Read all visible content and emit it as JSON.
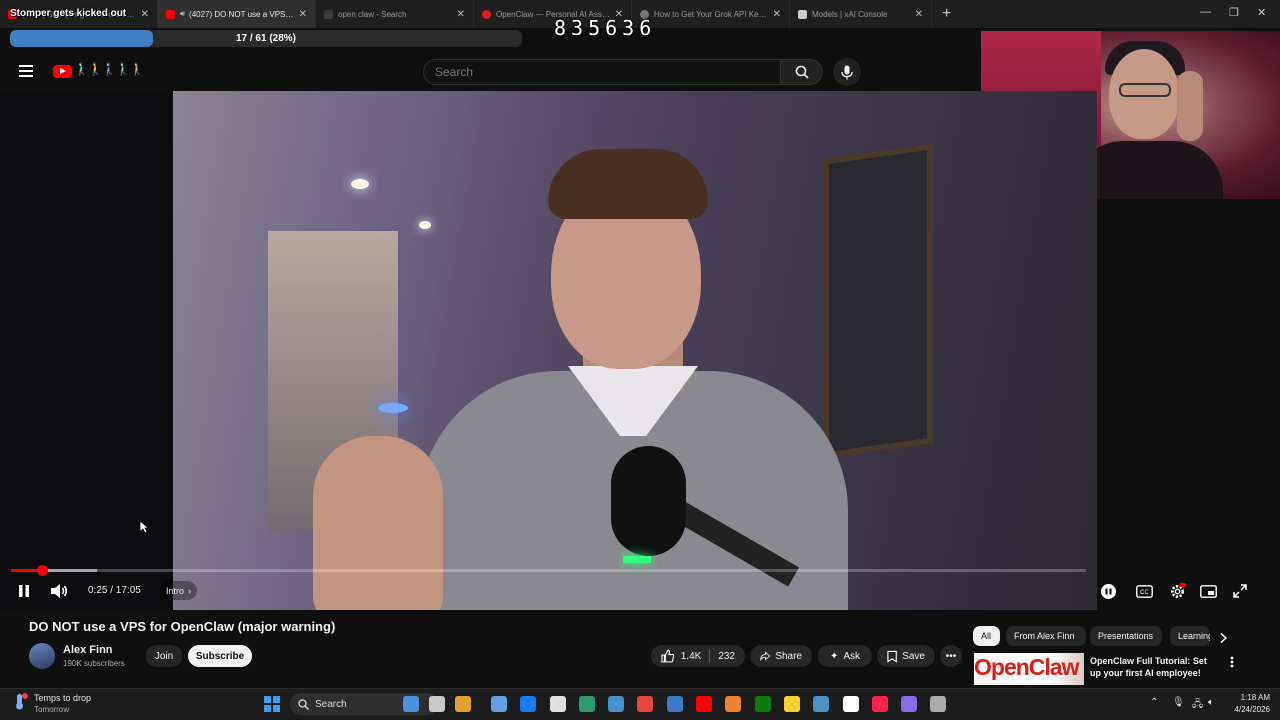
{
  "browser": {
    "tabs": [
      {
        "label": "(4027) Stomper gets kicked out - YouTube",
        "favicon_color": "#ff0000",
        "active": false
      },
      {
        "label": "(4027) DO NOT use a VPS for OpenClaw",
        "favicon_color": "#ff0000",
        "active": true
      },
      {
        "label": "open claw - Search",
        "favicon_color": "#3a3a3a",
        "active": false
      },
      {
        "label": "OpenClaw — Personal AI Assistant",
        "favicon_color": "#d8201a",
        "active": false
      },
      {
        "label": "How to Get Your Grok API Key - G",
        "favicon_color": "#777777",
        "active": false
      },
      {
        "label": "Models | xAI Console",
        "favicon_color": "#cccccc",
        "active": false
      }
    ],
    "new_tab_label": "+"
  },
  "overlay": {
    "title": "Stomper gets kicked out",
    "progress_text": "17 / 61 (28%)",
    "progress_fraction": 0.28,
    "counter": "835636"
  },
  "youtube": {
    "logo_figures": "🚶🏻‍♂️🚶🏻🚶🏻‍♀️🚶🏻‍♂️🚶🏻",
    "search_placeholder": "Search",
    "player": {
      "time": "0:25 / 17:05",
      "chapter": "Intro",
      "played_fraction": 0.029,
      "buffered_fraction": 0.08
    },
    "video": {
      "title": "DO NOT use a VPS for OpenClaw (major warning)",
      "channel": "Alex Finn",
      "subscribers": "190K subscribers",
      "join_label": "Join",
      "subscribe_label": "Subscribe",
      "likes": "1.4K",
      "comments": "232",
      "share_label": "Share",
      "ask_label": "Ask",
      "save_label": "Save"
    },
    "chips": [
      "All",
      "From Alex Finn",
      "Presentations",
      "Learning"
    ],
    "recommendation": {
      "thumb_text": "OpenClaw",
      "title": "OpenClaw Full Tutorial: Set up your first AI employee!"
    }
  },
  "taskbar": {
    "weather_line1": "Temps to drop",
    "weather_line2": "Tomorrow",
    "search_label": "Search",
    "time": "1:18 AM",
    "date": "4/24/2026",
    "app_colors": [
      "#4a8fe0",
      "#c8c8c8",
      "#e0a030",
      "#60a0e0",
      "#1877f2",
      "#e0e0e0",
      "#2a9d6a",
      "#4a90d0",
      "#e8463a",
      "#3a7ac8",
      "#ff0000",
      "#f08030",
      "#107c10",
      "#f7d02e",
      "#4a90c8",
      "#ffffff",
      "#ff2050",
      "#8a6ae8",
      "#aaaaaa"
    ]
  }
}
